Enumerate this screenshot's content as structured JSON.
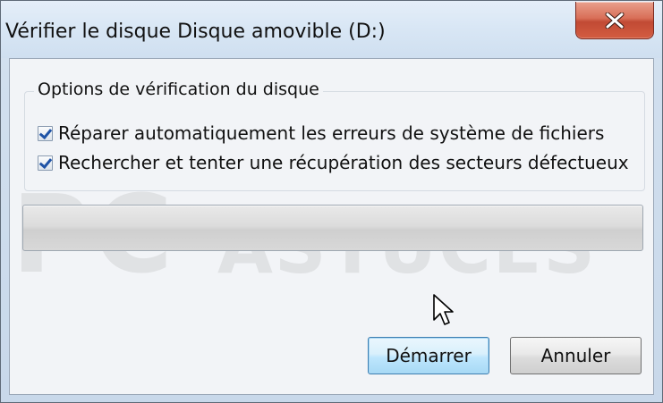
{
  "window": {
    "title": "Vérifier le disque Disque amovible (D:)",
    "close_icon": "close-icon"
  },
  "options_group": {
    "legend": "Options de vérification du disque",
    "options": [
      {
        "label": "Réparer automatiquement les erreurs de système de fichiers",
        "checked": true
      },
      {
        "label": "Rechercher et tenter une récupération des secteurs défectueux",
        "checked": true
      }
    ]
  },
  "progress": {
    "value": 0
  },
  "buttons": {
    "start_label": "Démarrer",
    "cancel_label": "Annuler"
  },
  "watermark": {
    "text_large": "PC",
    "text_small": "ASTUCES"
  },
  "colors": {
    "close_button": "#d35c41",
    "accent_button": "#bee6fd",
    "checkmark": "#1f53a6"
  }
}
